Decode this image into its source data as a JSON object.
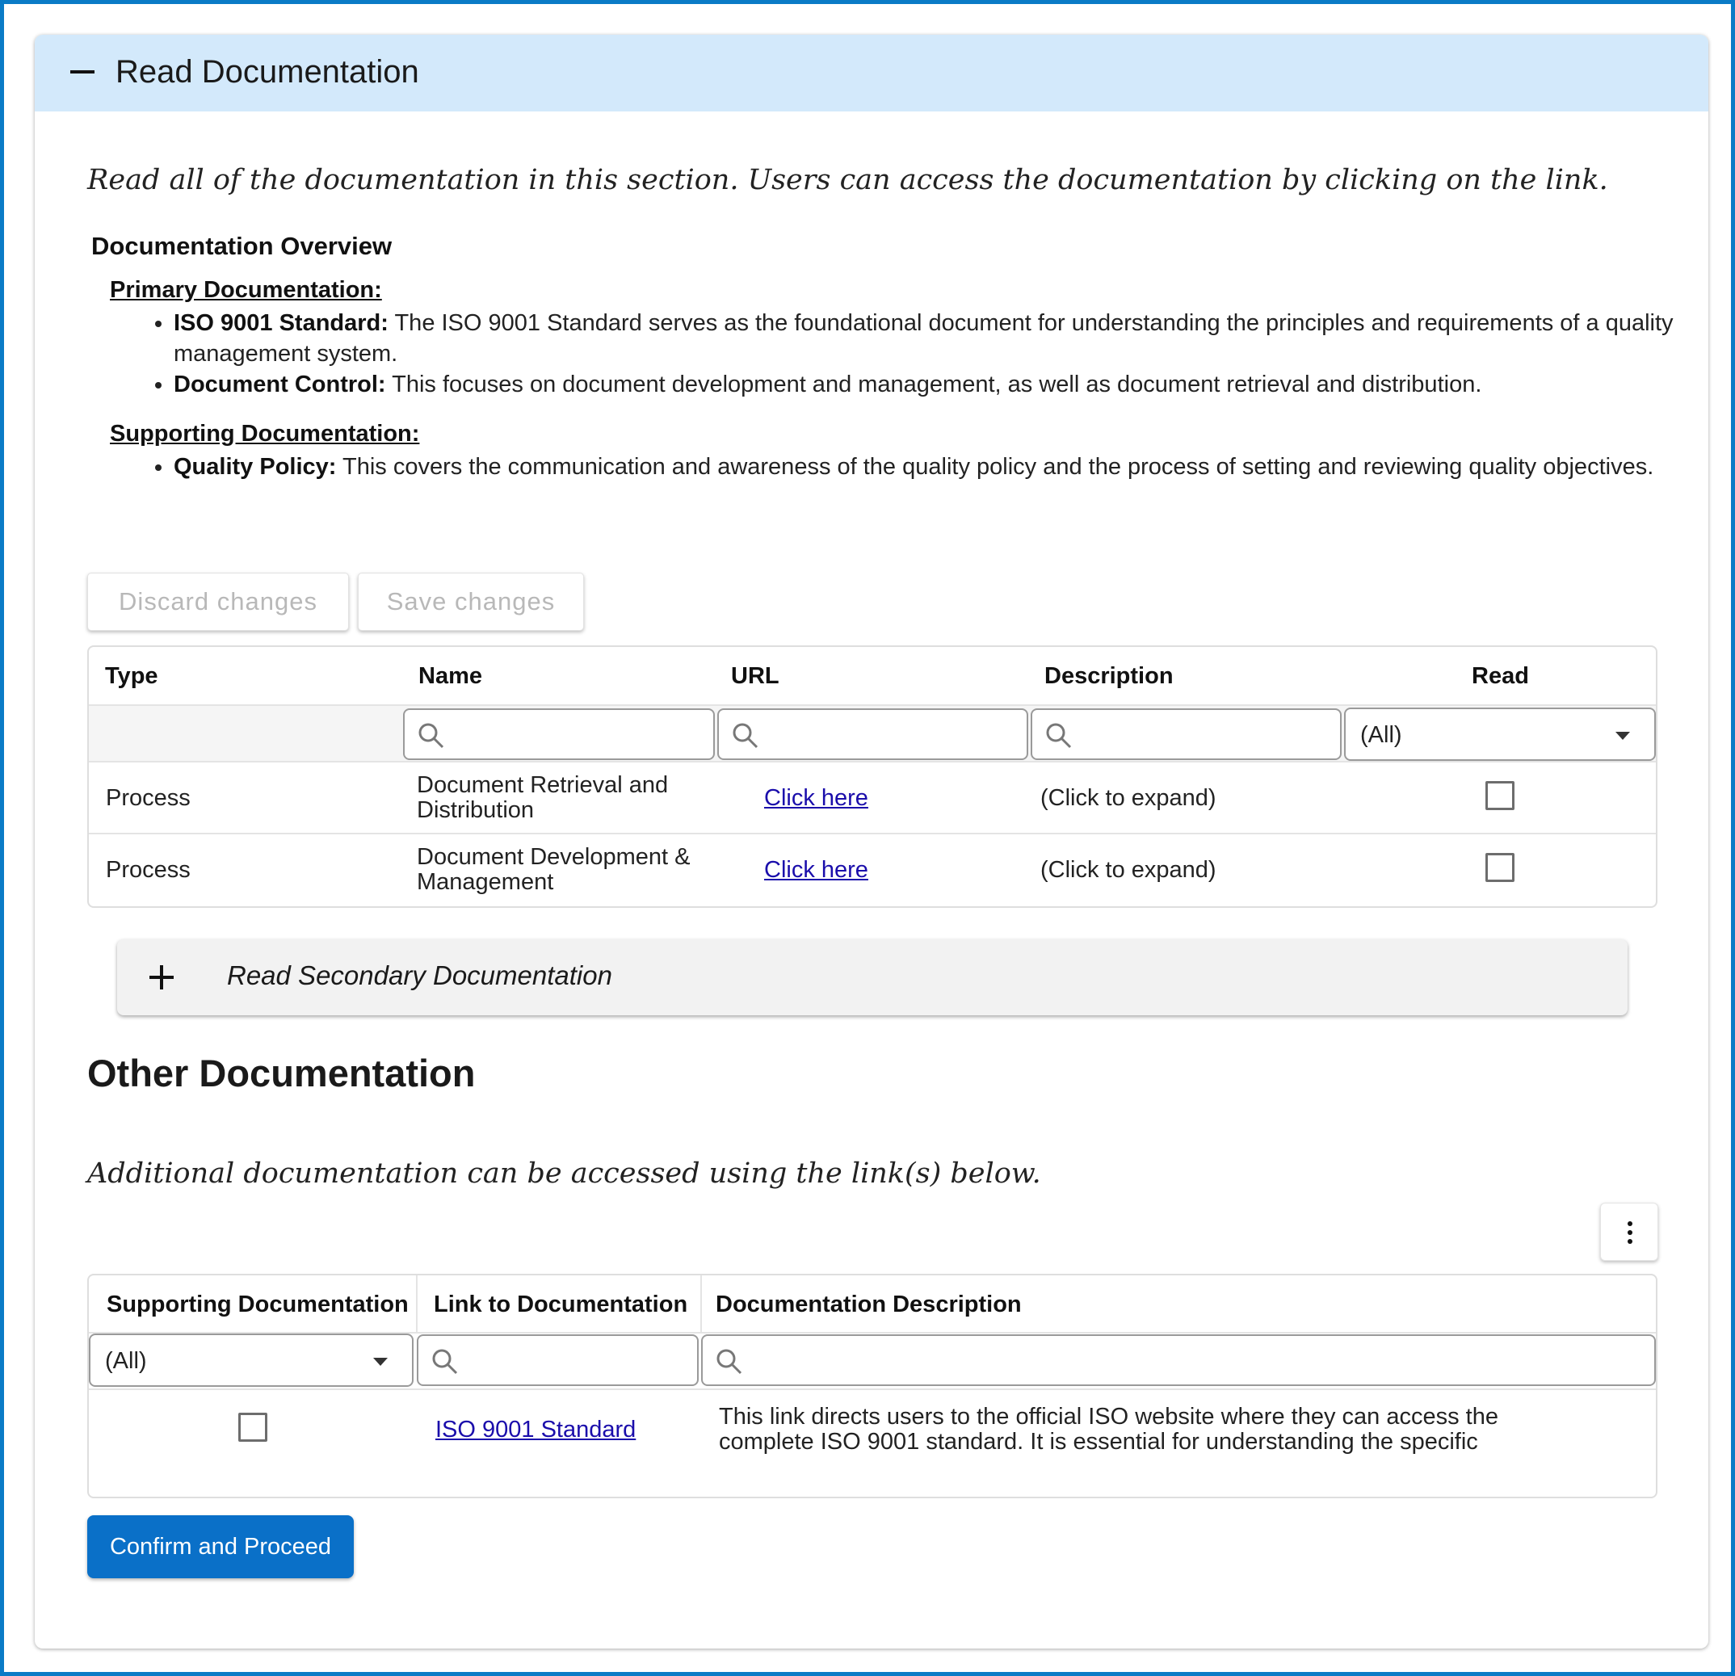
{
  "panel": {
    "title": "Read Documentation",
    "intro": "Read all of the documentation in this section. Users can access the documentation by clicking on the link."
  },
  "overview": {
    "title": "Documentation Overview",
    "primary": {
      "heading": "Primary Documentation:",
      "items": [
        {
          "term": "ISO 9001 Standard:",
          "text": " The ISO 9001 Standard serves as the foundational document for understanding the principles and requirements of a quality management system."
        },
        {
          "term": "Document Control:",
          "text": " This focuses on document development and management, as well as document retrieval and distribution."
        }
      ]
    },
    "supporting": {
      "heading": "Supporting Documentation:",
      "items": [
        {
          "term": "Quality Policy:",
          "text": " This covers the communication and awareness of the quality policy and the process of setting and reviewing quality objectives."
        }
      ]
    }
  },
  "toolbar": {
    "discard_label": "Discard changes",
    "save_label": "Save changes"
  },
  "docs_grid": {
    "columns": [
      "Type",
      "Name",
      "URL",
      "Description",
      "Read"
    ],
    "read_filter": "(All)",
    "rows": [
      {
        "type": "Process",
        "name_line1": "Document Retrieval and",
        "name_line2": "Distribution",
        "url": "Click here",
        "description": "(Click to expand)",
        "read": false
      },
      {
        "type": "Process",
        "name_line1": "Document Development &",
        "name_line2": "Management",
        "url": "Click here",
        "description": "(Click to expand)",
        "read": false
      }
    ]
  },
  "secondary": {
    "title": "Read Secondary Documentation"
  },
  "other": {
    "title": "Other Documentation",
    "subtitle": "Additional documentation can be accessed using the link(s) below."
  },
  "other_grid": {
    "columns": [
      "Supporting Documentation",
      "Link to Documentation",
      "Documentation Description"
    ],
    "supporting_filter": "(All)",
    "rows": [
      {
        "checked": false,
        "link": "ISO 9001 Standard",
        "desc_line1": "This link directs users to the official ISO website where they can access the",
        "desc_line2": "complete ISO 9001 standard. It is essential for understanding the specific"
      }
    ]
  },
  "confirm": {
    "label": "Confirm and Proceed"
  },
  "colors": {
    "frame": "#0a7bc6",
    "header_bg": "#d3e9fb",
    "primary_button": "#0a70c8",
    "link": "#1a0dab"
  }
}
